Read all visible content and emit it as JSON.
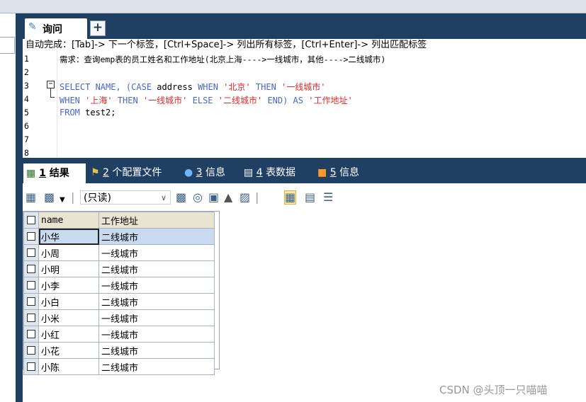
{
  "query_tab": {
    "icon": "query-icon",
    "label": "询问"
  },
  "new_tab_label": "+",
  "hint": "自动完成：[Tab]-> 下一个标签，[Ctrl+Space]-> 列出所有标签，[Ctrl+Enter]-> 列出匹配标签",
  "editor": {
    "line_numbers": [
      "1",
      "2",
      "3",
      "4",
      "5",
      "6",
      "7",
      "8"
    ],
    "line1": "需求：查询emp表的员工姓名和工作地址(北京上海---->一线城市，其他---->二线城市)",
    "line3": {
      "kw1": "SELECT NAME, (CASE",
      "plain1": " address ",
      "kw2": "WHEN",
      "str1": " '北京' ",
      "kw3": "THEN",
      "str2": " '一线城市'"
    },
    "line4": {
      "kw1": "WHEN",
      "str1": " '上海' ",
      "kw2": "THEN",
      "str2": " '一线城市' ",
      "kw3": "ELSE",
      "str3": " '二线城市' ",
      "kw4": "END) AS",
      "str4": " '工作地址'"
    },
    "line5": {
      "kw1": "FROM",
      "plain1": " test2;"
    }
  },
  "result_tabs": [
    {
      "num": "1",
      "label": "结果"
    },
    {
      "num": "2",
      "label": "个配置文件"
    },
    {
      "num": "3",
      "label": "信息"
    },
    {
      "num": "4",
      "label": "表数据"
    },
    {
      "num": "5",
      "label": "信息"
    }
  ],
  "toolbar": {
    "mode_value": "(只读)"
  },
  "grid": {
    "columns": [
      "name",
      "工作地址"
    ],
    "rows": [
      [
        "小华",
        "二线城市"
      ],
      [
        "小周",
        "一线城市"
      ],
      [
        "小明",
        "二线城市"
      ],
      [
        "小李",
        "一线城市"
      ],
      [
        "小白",
        "二线城市"
      ],
      [
        "小米",
        "一线城市"
      ],
      [
        "小红",
        "一线城市"
      ],
      [
        "小花",
        "二线城市"
      ],
      [
        "小陈",
        "二线城市"
      ]
    ]
  },
  "watermark": "CSDN @头顶一只喵喵"
}
